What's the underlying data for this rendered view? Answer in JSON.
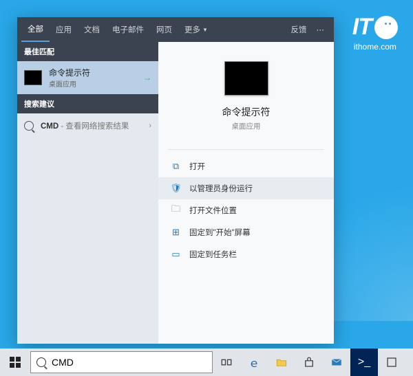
{
  "watermark": {
    "brand": "IT",
    "url": "ithome.com"
  },
  "header": {
    "tabs": [
      "全部",
      "应用",
      "文档",
      "电子邮件",
      "网页"
    ],
    "more": "更多",
    "feedback": "反馈"
  },
  "left": {
    "bestMatchHeader": "最佳匹配",
    "bestMatch": {
      "title": "命令提示符",
      "subtitle": "桌面应用"
    },
    "suggestHeader": "搜索建议",
    "suggestion": {
      "query": "CMD",
      "hint": " - 查看网络搜索结果"
    }
  },
  "preview": {
    "title": "命令提示符",
    "subtitle": "桌面应用",
    "actions": [
      {
        "icon": "open-icon",
        "label": "打开",
        "highlight": false
      },
      {
        "icon": "admin-icon",
        "label": "以管理员身份运行",
        "highlight": true
      },
      {
        "icon": "folder-icon",
        "label": "打开文件位置",
        "highlight": false
      },
      {
        "icon": "pin-start-icon",
        "label": "固定到\"开始\"屏幕",
        "highlight": false
      },
      {
        "icon": "pin-taskbar-icon",
        "label": "固定到任务栏",
        "highlight": false
      }
    ]
  },
  "taskbar": {
    "searchValue": "CMD"
  }
}
